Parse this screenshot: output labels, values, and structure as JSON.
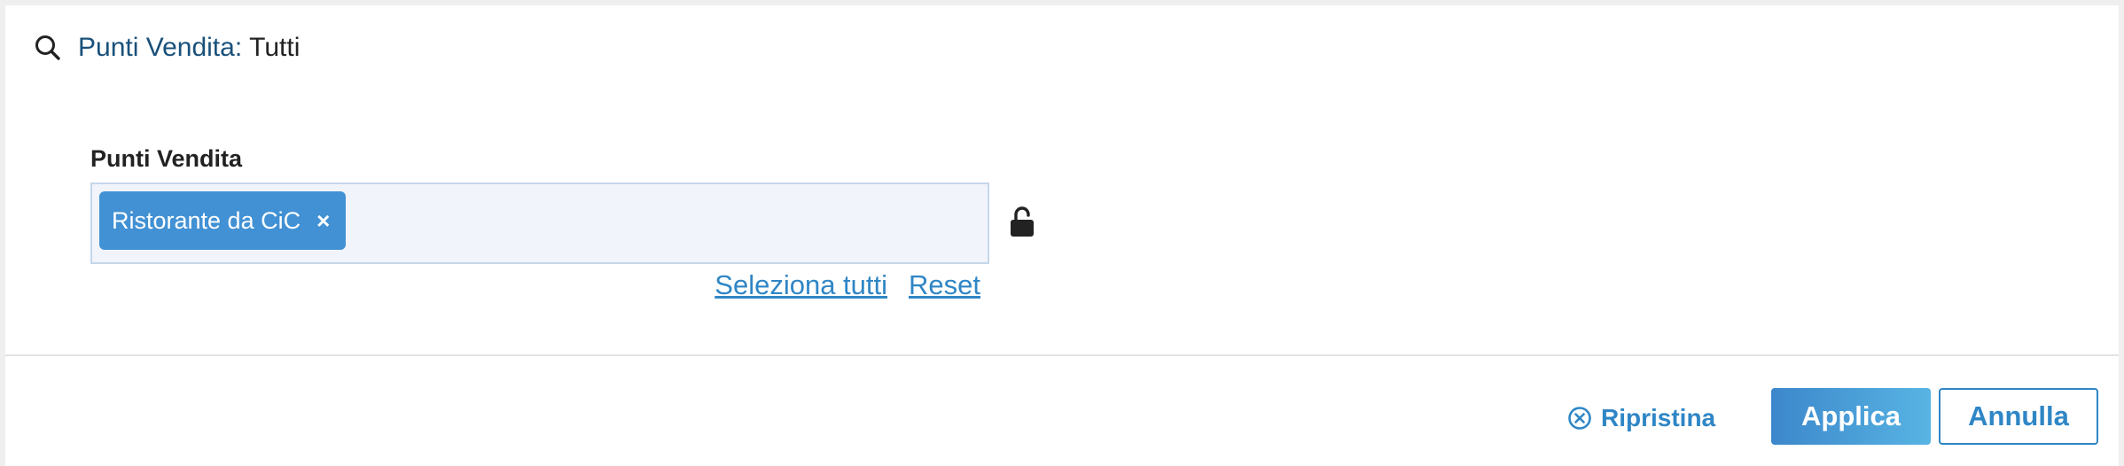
{
  "header": {
    "title_label": "Punti Vendita",
    "title_separator": ":",
    "title_value": "Tutti"
  },
  "field": {
    "label": "Punti Vendita",
    "selected_chips": [
      {
        "label": "Ristorante da CiC",
        "remove_glyph": "×"
      }
    ],
    "lock_icon": "lock-open-icon"
  },
  "links": {
    "select_all": "Seleziona tutti",
    "reset": "Reset"
  },
  "footer": {
    "restore_label": "Ripristina",
    "apply_label": "Applica",
    "cancel_label": "Annulla"
  },
  "colors": {
    "accent": "#2f86c6",
    "chip_bg": "#4191d4",
    "title": "#19507a",
    "input_bg": "#f1f4fa",
    "input_border": "#c6d6ea"
  }
}
